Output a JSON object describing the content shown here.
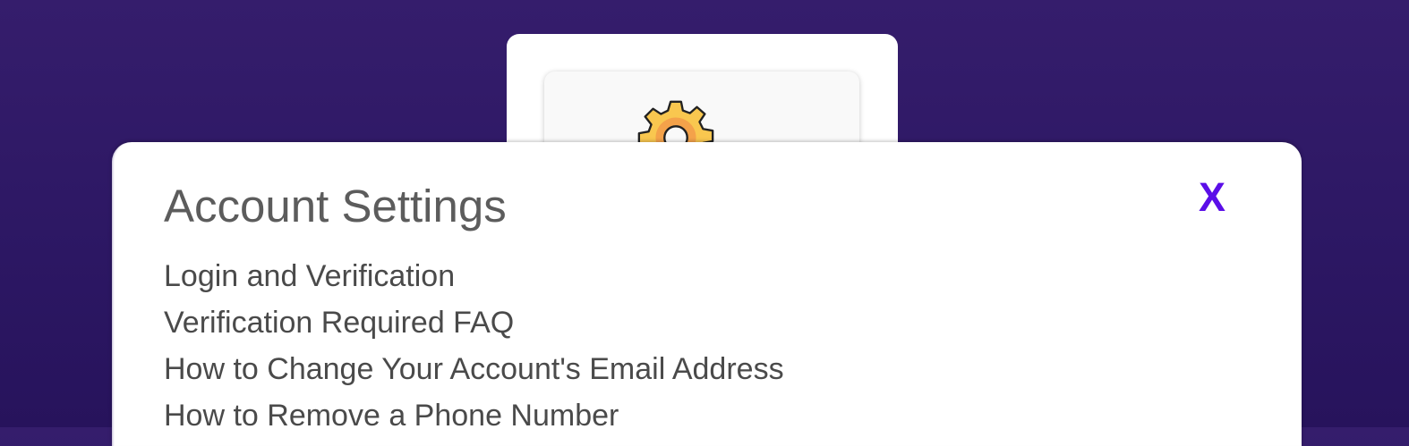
{
  "modal": {
    "title": "Account Settings",
    "close_label": "X",
    "links": [
      "Login and Verification",
      "Verification Required FAQ",
      "How to Change Your Account's Email Address",
      "How to Remove a Phone Number"
    ]
  },
  "background_card": {
    "icon": "gear-icon"
  },
  "colors": {
    "background": "#2e1866",
    "accent": "#5b0ee8",
    "title_text": "#5c5c5c",
    "link_text": "#4a4a4a",
    "gear_fill": "#f9c74f",
    "gear_ring": "#f4a24a"
  }
}
